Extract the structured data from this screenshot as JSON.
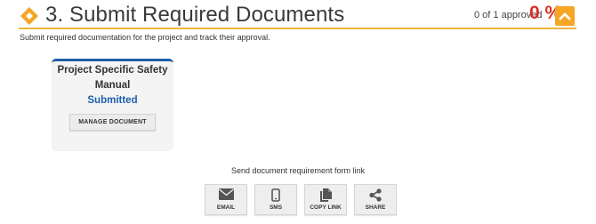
{
  "section": {
    "title": "3. Submit Required Documents",
    "subtitle": "Submit required documentation for the project and track their approval.",
    "progress_text": "0 of 1 approved",
    "progress_percent": "0 %",
    "progress_value": 0,
    "accent_color": "#f5a623",
    "percent_color": "#d93025"
  },
  "document": {
    "name": "Project Specific Safety Manual",
    "status": "Submitted",
    "status_color": "#1f5fa8",
    "manage_label": "MANAGE DOCUMENT"
  },
  "share": {
    "label": "Send document requirement form link",
    "buttons": [
      {
        "label": "EMAIL",
        "icon": "envelope-icon"
      },
      {
        "label": "SMS",
        "icon": "mobile-phone-icon"
      },
      {
        "label": "COPY LINK",
        "icon": "copy-document-icon"
      },
      {
        "label": "SHARE",
        "icon": "share-nodes-icon"
      }
    ]
  }
}
